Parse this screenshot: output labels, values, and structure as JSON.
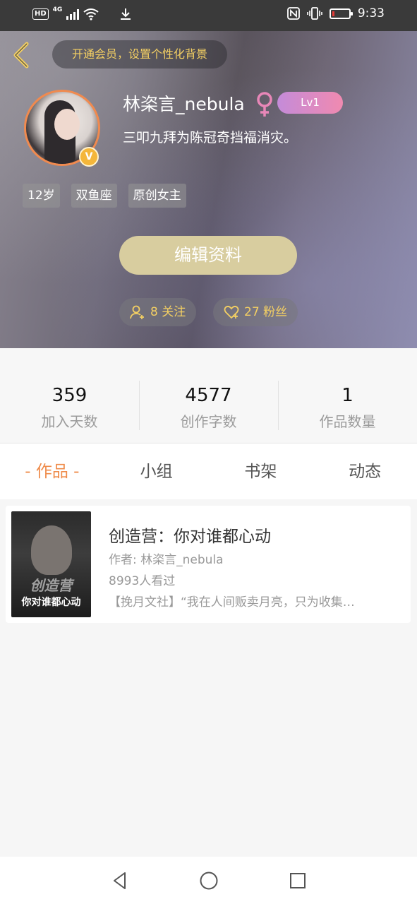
{
  "status_bar": {
    "network_badge": "HD",
    "network_type": "4G",
    "time": "9:33",
    "battery_level": 0.15,
    "icons": [
      "signal-icon",
      "wifi-icon",
      "download-icon",
      "nfc-icon",
      "vibrate-icon",
      "battery-icon"
    ]
  },
  "header": {
    "vip_banner": "开通会员，设置个性化背景",
    "username": "林栥言_nebula",
    "gender": "female",
    "level": "Lv1",
    "verified_badge": "V",
    "signature": "三叩九拜为陈冠奇挡福消灾。",
    "tags": [
      "12岁",
      "双鱼座",
      "原创女主"
    ],
    "edit_button": "编辑资料",
    "following": "8 关注",
    "fans": "27 粉丝",
    "accent_color": "#f3cf63"
  },
  "stats": [
    {
      "value": "359",
      "label": "加入天数"
    },
    {
      "value": "4577",
      "label": "创作字数"
    },
    {
      "value": "1",
      "label": "作品数量"
    }
  ],
  "tabs": [
    {
      "label": "- 作品 -",
      "active": true
    },
    {
      "label": "小组",
      "active": false
    },
    {
      "label": "书架",
      "active": false
    },
    {
      "label": "动态",
      "active": false
    }
  ],
  "works": [
    {
      "title": "创造营：你对谁都心动",
      "author": "作者: 林栥言_nebula",
      "views": "8993人看过",
      "description": "【挽月文社】“我在人间贩卖月亮，只为收集…",
      "cover_title": "你对谁都心动",
      "cover_subtitle": "创造营"
    }
  ],
  "navbar": {
    "icons": [
      "back-triangle-icon",
      "home-circle-icon",
      "recents-square-icon"
    ]
  }
}
